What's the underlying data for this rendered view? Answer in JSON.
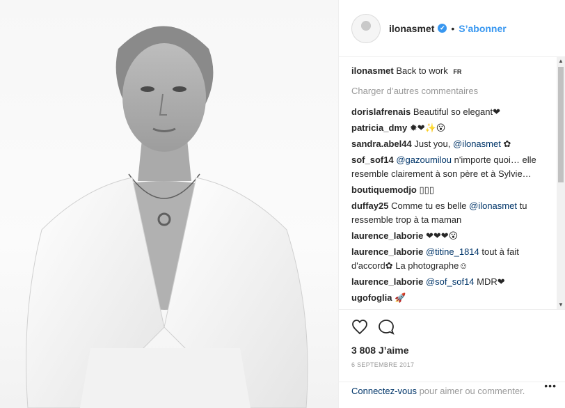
{
  "post": {
    "username": "ilonasmet",
    "verified_glyph": "✔",
    "separator": "•",
    "follow_label": "S’abonner"
  },
  "comments": {
    "caption": {
      "user": "ilonasmet",
      "text": "Back to work",
      "lang_badge": "FR"
    },
    "load_more": "Charger d’autres commentaires",
    "items": [
      {
        "user": "dorislafrenais",
        "text": "Beautiful so elegant❤"
      },
      {
        "user": "patricia_dmy",
        "text": "✹❤✨😮"
      },
      {
        "user": "sandra.abel44",
        "text_before": "Just you,",
        "mention": "@ilonasmet",
        "text_after": "✿"
      },
      {
        "user": "sof_sof14",
        "text_before": "",
        "mention": "@gazoumilou",
        "text_after": "n'importe quoi… elle resemble clairement à son père et à Sylvie…"
      },
      {
        "user": "boutiquemodjo",
        "text": "▯▯▯"
      },
      {
        "user": "duffay25",
        "text_before": "Comme tu es belle",
        "mention": "@ilonasmet",
        "text_after": "tu ressemble trop à ta maman"
      },
      {
        "user": "laurence_laborie",
        "text": "❤❤❤😮"
      },
      {
        "user": "laurence_laborie",
        "text_before": "",
        "mention": "@titine_1814",
        "text_after": "tout à fait d'accord✿ La photographe☺"
      },
      {
        "user": "laurence_laborie",
        "text_before": "",
        "mention": "@sof_sof14",
        "text_after": "MDR❤"
      },
      {
        "user": "ugofoglia",
        "text": "🚀"
      }
    ]
  },
  "actions": {
    "likes": "3 808 J’aime",
    "date": "6 septembre 2017"
  },
  "login": {
    "link_label": "Connectez-vous",
    "text": "pour aimer ou commenter.",
    "more_glyph": "•••"
  },
  "icons": {
    "heart": "heart-icon",
    "comment": "comment-icon",
    "verified": "verified-badge-icon"
  },
  "colors": {
    "accent": "#3897f0",
    "mention": "#003569",
    "muted": "#999999"
  }
}
